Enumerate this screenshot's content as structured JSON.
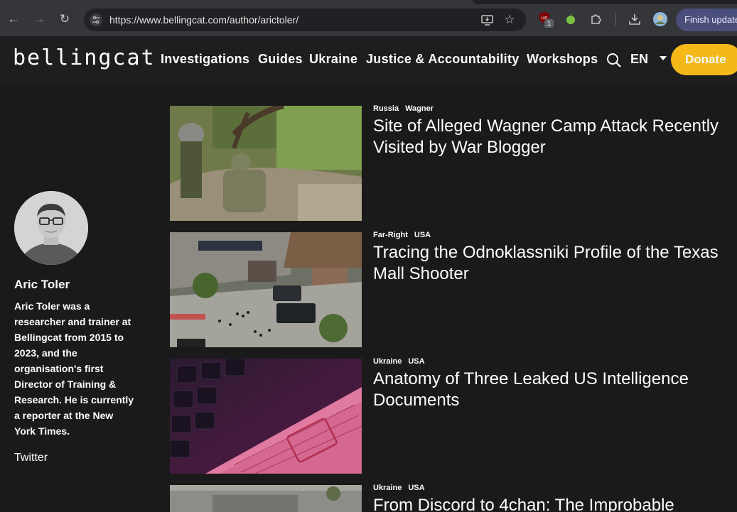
{
  "browser": {
    "url": "https://www.bellingcat.com/author/arictoler/",
    "finish_update_label": "Finish update",
    "ext_badge": "1"
  },
  "site": {
    "logo": "bellingcat",
    "nav": [
      "Investigations",
      "Guides",
      "Ukraine",
      "Justice & Accountability",
      "Workshops"
    ],
    "language": "EN",
    "donate_label": "Donate",
    "accent_color": "#f5b819"
  },
  "author": {
    "name": "Aric Toler",
    "bio": "Aric Toler was a researcher and trainer at Bellingcat from 2015 to 2023, and the organisation's first Director of Training & Research. He is currently a reporter at the New York Times.",
    "twitter_label": "Twitter"
  },
  "articles": [
    {
      "tags": [
        "Russia",
        "Wagner"
      ],
      "title": "Site of Alleged Wagner Camp Attack Recently Visited by War Blogger"
    },
    {
      "tags": [
        "Far-Right",
        "USA"
      ],
      "title": "Tracing the Odnoklassniki Profile of the Texas Mall Shooter"
    },
    {
      "tags": [
        "Ukraine",
        "USA"
      ],
      "title": "Anatomy of Three Leaked US Intelligence Documents"
    },
    {
      "tags": [
        "Ukraine",
        "USA"
      ],
      "title": "From Discord to 4chan: The Improbable"
    }
  ]
}
